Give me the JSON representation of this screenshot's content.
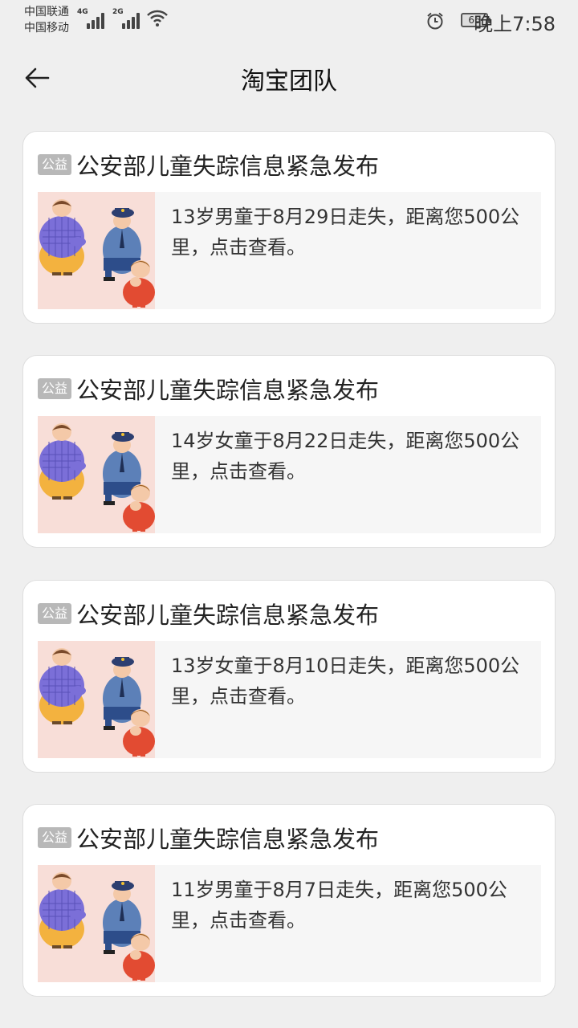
{
  "status": {
    "carrier1": "中国联通",
    "carrier2": "中国移动",
    "net1": "4G",
    "net2": "2G",
    "battery": "66",
    "time": "晚上7:58"
  },
  "header": {
    "title": "淘宝团队"
  },
  "cards": [
    {
      "badge": "公益",
      "title": "公安部儿童失踪信息紧急发布",
      "desc": "13岁男童于8月29日走失，距离您500公里，点击查看。"
    },
    {
      "badge": "公益",
      "title": "公安部儿童失踪信息紧急发布",
      "desc": "14岁女童于8月22日走失，距离您500公里，点击查看。"
    },
    {
      "badge": "公益",
      "title": "公安部儿童失踪信息紧急发布",
      "desc": "13岁女童于8月10日走失，距离您500公里，点击查看。"
    },
    {
      "badge": "公益",
      "title": "公安部儿童失踪信息紧急发布",
      "desc": "11岁男童于8月7日走失，距离您500公里，点击查看。"
    }
  ]
}
